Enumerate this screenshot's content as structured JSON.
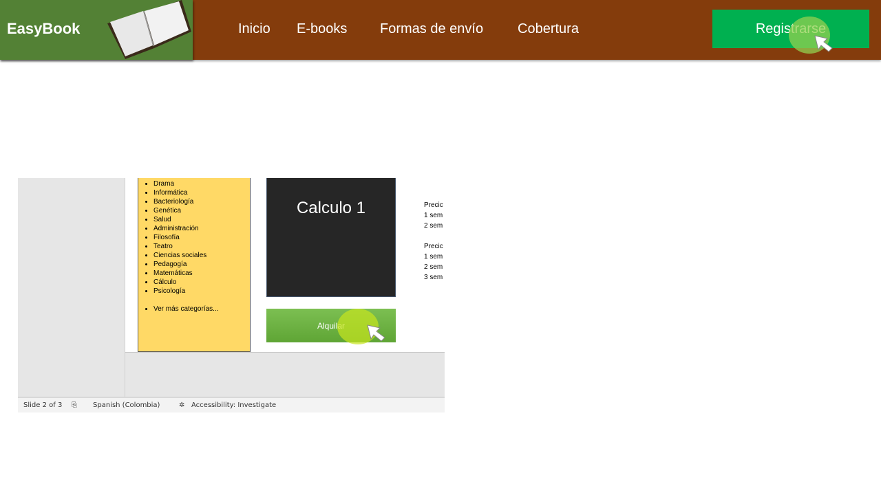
{
  "header": {
    "logo": "EasyBook",
    "nav": [
      "Inicio",
      "E-books",
      "Formas de envío",
      "Cobertura"
    ],
    "register": "Registrarse"
  },
  "screenshot": {
    "categories": [
      "Drama",
      "Informática",
      "Bacteriología",
      "Genética",
      "Salud",
      "Administración",
      "Filosofía",
      "Teatro",
      "Ciencias sociales",
      "Pedagogía",
      "Matemáticas",
      "Cálculo",
      "Psicología"
    ],
    "more_categories": "Ver más categorías...",
    "book_title": "Calculo 1",
    "rent_button": "Alquilar",
    "prices": [
      "Precic",
      "1 sem",
      "2 sem",
      "",
      "Precic",
      "1 sem",
      "2 sem",
      "3 sem"
    ],
    "status": {
      "slide": "Slide 2 of 3",
      "language": "Spanish (Colombia)",
      "accessibility": "Accessibility: Investigate"
    }
  },
  "colors": {
    "header": "#843c0c",
    "logo_bg": "#538135",
    "register": "#00b050",
    "categories_bg": "#ffd966",
    "cover": "#262626"
  }
}
